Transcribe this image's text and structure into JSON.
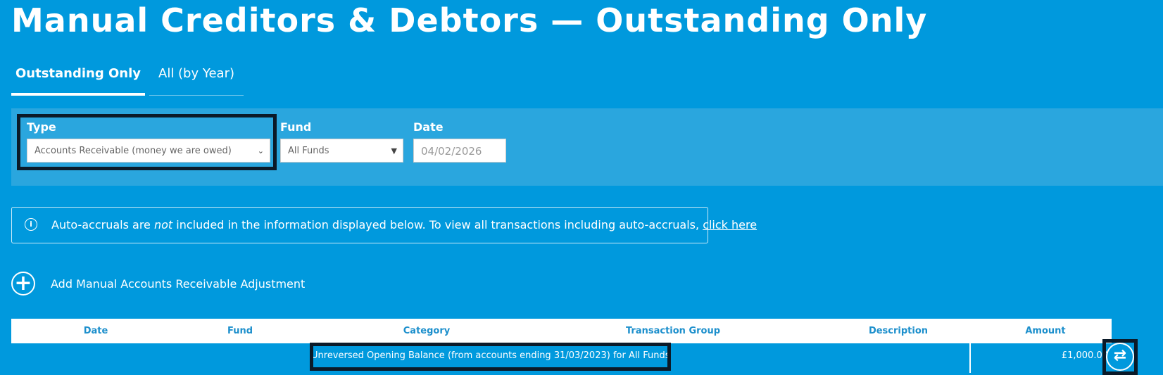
{
  "page": {
    "title": "Manual Creditors & Debtors — Outstanding Only"
  },
  "tabs": [
    {
      "label": "Outstanding Only",
      "active": true
    },
    {
      "label": "All (by Year)",
      "active": false
    }
  ],
  "filters": {
    "type": {
      "label": "Type",
      "value": "Accounts Receivable (money we are owed)"
    },
    "fund": {
      "label": "Fund",
      "value": "All Funds"
    },
    "date": {
      "label": "Date",
      "value": "04/02/2026"
    }
  },
  "info": {
    "icon": "info-icon",
    "text_before": "Auto-accruals are ",
    "text_em": "not",
    "text_after": " included in the information displayed below. To view all transactions including auto-accruals, ",
    "link_label": "click here"
  },
  "add_action": {
    "icon": "plus-circle-icon",
    "label": "Add Manual Accounts Receivable Adjustment"
  },
  "table": {
    "columns": [
      "Date",
      "Fund",
      "Category",
      "Transaction Group",
      "Description",
      "Amount"
    ],
    "rows": [
      {
        "date": "",
        "fund": "",
        "category": "Unreversed Opening Balance (from accounts ending 31/03/2023) for All Funds",
        "transaction_group": "",
        "description": "",
        "amount": "£1,000.00",
        "action_icon": "swap-arrows-icon"
      }
    ]
  },
  "colors": {
    "background": "#0099dd",
    "panel": "#2aa6de",
    "header_text": "#1c8fcc",
    "highlight": "#0b1a28"
  }
}
